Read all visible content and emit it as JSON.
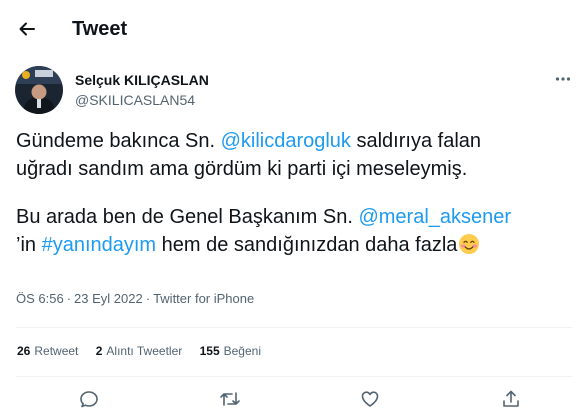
{
  "header": {
    "title": "Tweet",
    "back_icon": "arrow-left-icon"
  },
  "author": {
    "name": "Selçuk KILIÇASLAN",
    "handle": "@SKILICASLAN54"
  },
  "tweet": {
    "line1_pre": "Gündeme bakınca Sn. ",
    "line1_mention": "@kilicdarogluk",
    "line1_post": " saldırıya falan",
    "line2": "uğradı sandım ama gördüm ki parti içi meseleymiş.",
    "line3_pre": "Bu arada ben de Genel Başkanım Sn. ",
    "line3_mention": "@meral_aksener",
    "line4_pre": "’in ",
    "line4_hashtag": "#yanındayım",
    "line4_post": " hem de sandığınızdan daha fazla",
    "emoji": "smiling-face-icon"
  },
  "meta": {
    "time": "ÖS 6:56",
    "date": "23 Eyl 2022",
    "separator": "·",
    "source": "Twitter for iPhone"
  },
  "stats": [
    {
      "count": "26",
      "label": "Retweet"
    },
    {
      "count": "2",
      "label": "Alıntı Tweetler"
    },
    {
      "count": "155",
      "label": "Beğeni"
    }
  ],
  "actions": [
    "reply-icon",
    "retweet-icon",
    "like-icon",
    "share-icon"
  ],
  "colors": {
    "link": "#1d9bf0",
    "text": "#0f1419",
    "muted": "#536471",
    "divider": "#eff3f4"
  }
}
